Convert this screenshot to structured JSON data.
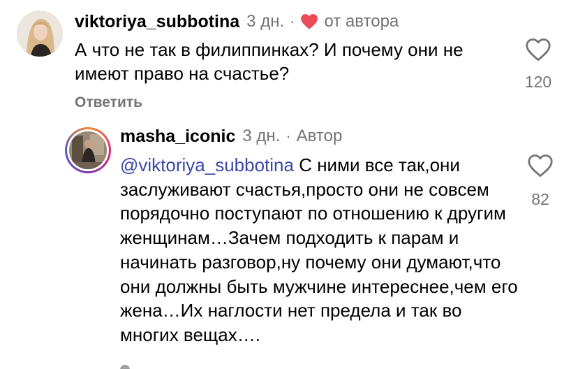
{
  "comment1": {
    "username": "viktoriya_subbotina",
    "time": "3 дн.",
    "separator": "·",
    "author_like_icon": "heart-filled-icon",
    "author_like_label": "от автора",
    "text": "А что не так в филиппинках? И почему они не имеют право на счастье?",
    "reply_label": "Ответить",
    "like_icon": "heart-outline-icon",
    "like_count": "120"
  },
  "comment2": {
    "username": "masha_iconic",
    "time": "3 дн.",
    "separator": "·",
    "author_badge": "Автор",
    "mention": "@viktoriya_subbotina",
    "text": " С ними все так,они заслуживают счастья,просто они не совсем порядочно поступают по отношению к другим женщинам…Зачем подходить к парам и начинать разговор,ну почему они думают,что они должны быть мужчине интереснее,чем его жена…Их наглости нет предела и так во многих вещах….",
    "like_icon": "heart-outline-icon",
    "like_count": "82"
  },
  "colors": {
    "heart_red": "#ed4956",
    "secondary_text": "#737373",
    "mention": "#3a47a9"
  }
}
